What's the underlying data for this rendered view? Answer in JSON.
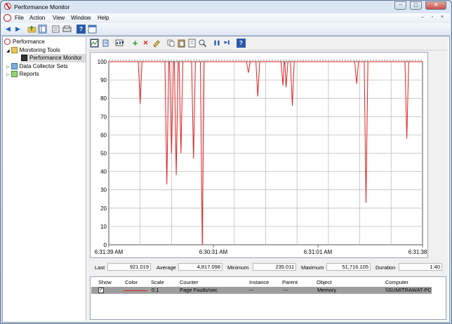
{
  "window": {
    "title": "Performance Monitor",
    "min_glyph": "─",
    "max_glyph": "▢",
    "close_glyph": "✕"
  },
  "menu": {
    "items": [
      "File",
      "Action",
      "View",
      "Window",
      "Help"
    ],
    "mdi_min": "–",
    "mdi_restore": "▫",
    "mdi_close": "×"
  },
  "tree": {
    "root": "Performance",
    "monitoring_tools": "Monitoring Tools",
    "performance_monitor": "Performance Monitor",
    "data_collector_sets": "Data Collector Sets",
    "reports": "Reports"
  },
  "chart_data": {
    "type": "line",
    "ylim": [
      0,
      100
    ],
    "yticks": [
      0,
      10,
      20,
      30,
      40,
      50,
      60,
      70,
      80,
      90,
      100
    ],
    "x_tick_labels": [
      "6:31:39 AM",
      "6:30:31 AM",
      "6:31:01 AM",
      "6:31:38 AM"
    ],
    "grid": true,
    "series": [
      {
        "color": "#e02020",
        "values": [
          100,
          100,
          100,
          100,
          100,
          100,
          100,
          100,
          100,
          100,
          100,
          100,
          77,
          100,
          100,
          100,
          100,
          100,
          100,
          100,
          100,
          33,
          50,
          38,
          50,
          100,
          100,
          100,
          100,
          100,
          47,
          100,
          100,
          0,
          100,
          100,
          100,
          100,
          100,
          100,
          100,
          100,
          100,
          100,
          100,
          100,
          100,
          100,
          100,
          100,
          94,
          100,
          100,
          81,
          100,
          100,
          100,
          100,
          100,
          100,
          100,
          100,
          87,
          86,
          100,
          76,
          100,
          100,
          100,
          100,
          100,
          100,
          100,
          100,
          100,
          100,
          100,
          100,
          100,
          100,
          100,
          100,
          100,
          100,
          100,
          100,
          100,
          100,
          100,
          100,
          100,
          100,
          100,
          100,
          100,
          100,
          100,
          100,
          100,
          100,
          100,
          100,
          100,
          100,
          100,
          100,
          100,
          100,
          100,
          100,
          100,
          100,
          100,
          100,
          100,
          100,
          100,
          100,
          100,
          100,
          100,
          100,
          100,
          100,
          100,
          100,
          100,
          100,
          100,
          100,
          100,
          100,
          100,
          100,
          100,
          100,
          100,
          100,
          100,
          100,
          100,
          100,
          100,
          100,
          100,
          100,
          100,
          100,
          100,
          100,
          100,
          100,
          100,
          100,
          100,
          100,
          100,
          100,
          100,
          100,
          100,
          100,
          100,
          100,
          100,
          100,
          100,
          100,
          100,
          100,
          100,
          100,
          100,
          100,
          100,
          100,
          100,
          100,
          100,
          100,
          100,
          100,
          100,
          100,
          100,
          100,
          100,
          100,
          100,
          100,
          100,
          100,
          100,
          100,
          100,
          100,
          100,
          100,
          100,
          100,
          100,
          100,
          100,
          100,
          100,
          100,
          100,
          100,
          100,
          100,
          100,
          100,
          100,
          100,
          100,
          100,
          100,
          100,
          100,
          100,
          100,
          100,
          100,
          100,
          100,
          100,
          100,
          100,
          100,
          100,
          100,
          100,
          100,
          100,
          100,
          100,
          100,
          100,
          100,
          100,
          100,
          100,
          100,
          100,
          100,
          100,
          100,
          100,
          100,
          100,
          100,
          100,
          100,
          100,
          100,
          100,
          100,
          100,
          100,
          100,
          100,
          100,
          100,
          100,
          100,
          100,
          100,
          100,
          100,
          100,
          100,
          100,
          100,
          100,
          100,
          100,
          100,
          100,
          100,
          100,
          100,
          100,
          100,
          100,
          100,
          100,
          100,
          100,
          100,
          100,
          100,
          100,
          100,
          100,
          100,
          100,
          100,
          100,
          100,
          100,
          100,
          100,
          100,
          100,
          100,
          100,
          100,
          100,
          100,
          100,
          100,
          100,
          100,
          100,
          100,
          100,
          100,
          100,
          100,
          100,
          100,
          100,
          100,
          100,
          100,
          100,
          100,
          100,
          100,
          100,
          100,
          100,
          100,
          100,
          100,
          100,
          100,
          100,
          100,
          100,
          100,
          100,
          100,
          100,
          100,
          100,
          100,
          100,
          100,
          100,
          100,
          100,
          100,
          100,
          100,
          100,
          100,
          100,
          100,
          100,
          100,
          100,
          100,
          100,
          100,
          100,
          100,
          100,
          100,
          100,
          100,
          100,
          100,
          100,
          100,
          100,
          100,
          100,
          100,
          100,
          100,
          100,
          100,
          100,
          100,
          100,
          100,
          100,
          100,
          100,
          100,
          100,
          100,
          100,
          100,
          100,
          100,
          100,
          100,
          100,
          100,
          100,
          100,
          100,
          100,
          100,
          100,
          100,
          100,
          100,
          100,
          100,
          100,
          100,
          100,
          100,
          100,
          100,
          100,
          100,
          100,
          100,
          100,
          100,
          100,
          100,
          100,
          100,
          100,
          100,
          100,
          100,
          100,
          100,
          100,
          100,
          100,
          100,
          100,
          100,
          100,
          100,
          100,
          100,
          100,
          100,
          100,
          100,
          100,
          100,
          100,
          100,
          100,
          100,
          100,
          100,
          100,
          100,
          100,
          100,
          100,
          100,
          100,
          100,
          100,
          100,
          100,
          100,
          100,
          100,
          100,
          100,
          100,
          100,
          100,
          100,
          100,
          100,
          100,
          100,
          100,
          100,
          100,
          100,
          100,
          100,
          100,
          100,
          100,
          100,
          100,
          100,
          100,
          100,
          100,
          100,
          100,
          100,
          100,
          100,
          100,
          100
        ]
      }
    ],
    "dips": [
      {
        "at": 0.1,
        "value": 77
      },
      {
        "at": 0.185,
        "value": 33
      },
      {
        "at": 0.2,
        "value": 50
      },
      {
        "at": 0.215,
        "value": 38
      },
      {
        "at": 0.23,
        "value": 50
      },
      {
        "at": 0.27,
        "value": 47
      },
      {
        "at": 0.298,
        "value": 0
      },
      {
        "at": 0.445,
        "value": 94
      },
      {
        "at": 0.475,
        "value": 81
      },
      {
        "at": 0.555,
        "value": 87
      },
      {
        "at": 0.565,
        "value": 86
      },
      {
        "at": 0.585,
        "value": 76
      },
      {
        "at": 0.79,
        "value": 88
      },
      {
        "at": 0.82,
        "value": 23
      },
      {
        "at": 0.85,
        "value": 100
      },
      {
        "at": 0.95,
        "value": 58
      }
    ]
  },
  "stats": {
    "last_label": "Last",
    "last_value": "921.019",
    "average_label": "Average",
    "average_value": "4,817.098",
    "minimum_label": "Minimum",
    "minimum_value": "235.011",
    "maximum_label": "Maximum",
    "maximum_value": "51,716.105",
    "duration_label": "Duration",
    "duration_value": "1:40"
  },
  "legend": {
    "headers": {
      "show": "Show",
      "color": "Color",
      "scale": "Scale",
      "counter": "Counter",
      "instance": "Instance",
      "parent": "Parent",
      "object": "Object",
      "computer": "Computer"
    },
    "rows": [
      {
        "show_checked": true,
        "line_color": "#e02020",
        "scale": "0.1",
        "counter": "Page Faults/sec",
        "instance": "---",
        "parent": "---",
        "object": "Memory",
        "computer": "\\\\SUMITRAWAT-PC"
      }
    ]
  },
  "toolbar": {
    "back_glyph": "◀",
    "forward_glyph": "▶",
    "help_glyph": "?",
    "add_glyph": "+",
    "delete_glyph": "✕",
    "pause_glyph": "❚❚",
    "next_glyph": "▶❚",
    "dropdown_glyph": "▾"
  }
}
